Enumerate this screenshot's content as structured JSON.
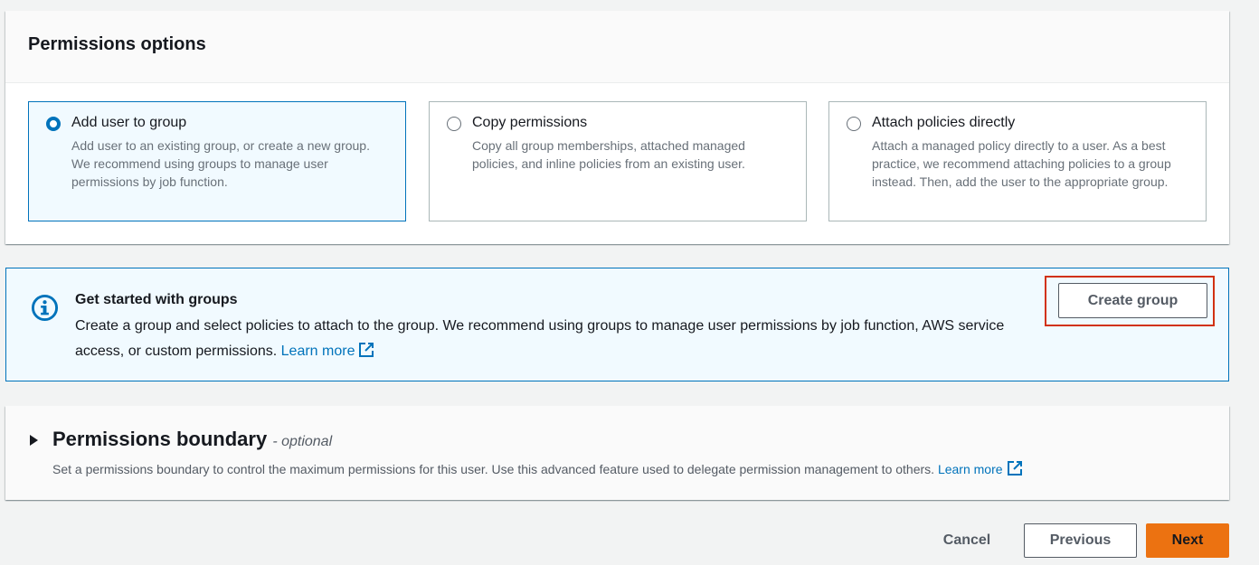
{
  "permissions": {
    "title": "Permissions options",
    "options": [
      {
        "label": "Add user to group",
        "description": "Add user to an existing group, or create a new group. We recommend using groups to manage user permissions by job function.",
        "selected": true
      },
      {
        "label": "Copy permissions",
        "description": "Copy all group memberships, attached managed policies, and inline policies from an existing user.",
        "selected": false
      },
      {
        "label": "Attach policies directly",
        "description": "Attach a managed policy directly to a user. As a best practice, we recommend attaching policies to a group instead. Then, add the user to the appropriate group.",
        "selected": false
      }
    ]
  },
  "info": {
    "icon": "info-icon",
    "title": "Get started with groups",
    "body": "Create a group and select policies to attach to the group. We recommend using groups to manage user permissions by job function, AWS service access, or custom permissions.",
    "link": "Learn more",
    "button": "Create group"
  },
  "boundary": {
    "title": "Permissions boundary",
    "optional": "- optional",
    "description": "Set a permissions boundary to control the maximum permissions for this user. Use this advanced feature used to delegate permission management to others.",
    "link": "Learn more"
  },
  "footer": {
    "cancel": "Cancel",
    "previous": "Previous",
    "next": "Next"
  },
  "colors": {
    "accent": "#0073bb",
    "primary_button": "#ec7211",
    "highlight": "#d13212"
  }
}
